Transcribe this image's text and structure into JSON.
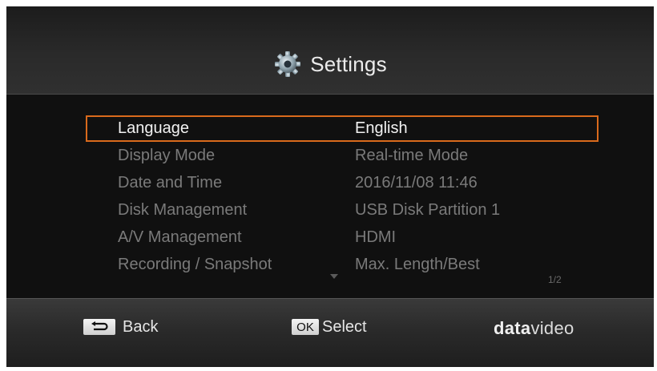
{
  "header": {
    "title": "Settings",
    "icon": "gear-icon"
  },
  "settings": {
    "rows": [
      {
        "label": "Language",
        "value": "English",
        "selected": true
      },
      {
        "label": "Display Mode",
        "value": "Real-time Mode",
        "selected": false
      },
      {
        "label": "Date and Time",
        "value": "2016/11/08 11:46",
        "selected": false
      },
      {
        "label": "Disk Management",
        "value": "USB Disk Partition 1",
        "selected": false
      },
      {
        "label": "A/V Management",
        "value": "HDMI",
        "selected": false
      },
      {
        "label": "Recording / Snapshot",
        "value": "Max. Length/Best",
        "selected": false
      }
    ],
    "page_indicator": "1/2"
  },
  "footer": {
    "back_label": "Back",
    "ok_key": "OK",
    "select_label": "Select",
    "brand_bold": "data",
    "brand_light": "video"
  },
  "colors": {
    "selection_border": "#d96a1c",
    "active_text": "#f2f2f2",
    "inactive_text": "#7a7a7a"
  }
}
